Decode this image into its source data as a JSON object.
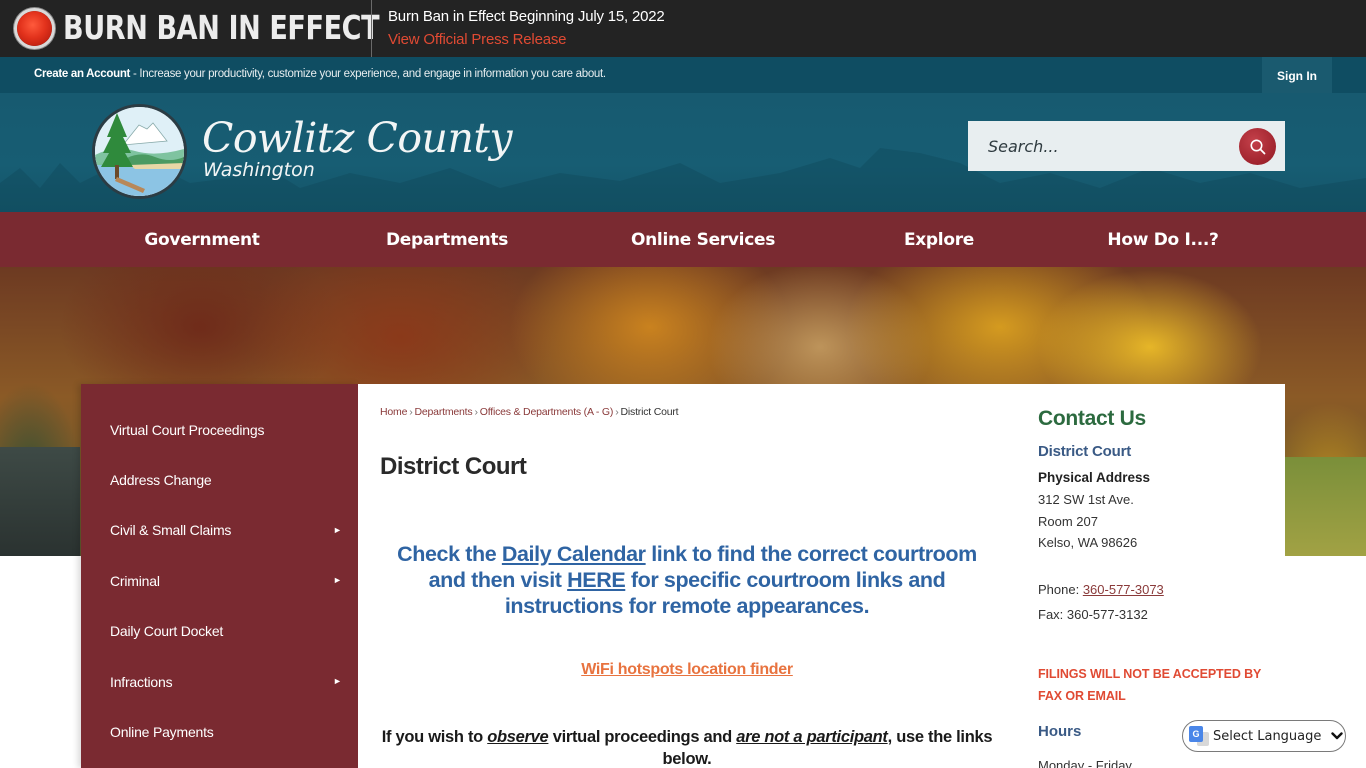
{
  "alert": {
    "title": "BURN BAN IN EFFECT",
    "headline": "Burn Ban in Effect Beginning July 15, 2022",
    "link_label": "View Official Press Release",
    "accent_color": "#e04a33"
  },
  "account": {
    "create_label": "Create an Account",
    "description": " - Increase your productivity, customize your experience, and engage in information you care about.",
    "sign_in_label": "Sign In"
  },
  "header": {
    "logo_title": "Cowlitz County",
    "logo_subtitle": "Washington",
    "search_placeholder": "Search...",
    "search_icon": "search-icon"
  },
  "nav": {
    "items": [
      {
        "label": "Government"
      },
      {
        "label": "Departments"
      },
      {
        "label": "Online Services"
      },
      {
        "label": "Explore"
      },
      {
        "label": "How Do I...?"
      }
    ]
  },
  "sidebar": {
    "items": [
      {
        "label": "Virtual Court Proceedings",
        "has_submenu": false
      },
      {
        "label": "Address Change",
        "has_submenu": false
      },
      {
        "label": "Civil & Small Claims",
        "has_submenu": true
      },
      {
        "label": "Criminal",
        "has_submenu": true
      },
      {
        "label": "Daily Court Docket",
        "has_submenu": false
      },
      {
        "label": "Infractions",
        "has_submenu": true
      },
      {
        "label": "Online Payments",
        "has_submenu": false
      }
    ],
    "arrow_glyph": "►"
  },
  "breadcrumb": {
    "items": [
      "Home",
      "Departments",
      "Offices & Departments (A - G)"
    ],
    "current": "District Court",
    "separator": "›"
  },
  "page": {
    "title": "District Court",
    "notice": {
      "part1": "Check the ",
      "link1": "Daily Calendar",
      "part2": " link to find the correct courtroom and then visit ",
      "link2": "HERE",
      "part3": " for specific courtroom links and instructions for remote appearances."
    },
    "wifi_link": "WiFi hotspots location finder",
    "observe": {
      "part1": "If you wish to ",
      "em1": "observe",
      "part2": " virtual proceedings and ",
      "em2": "are not a participant",
      "part3": ", use the links below."
    }
  },
  "contact": {
    "title": "Contact Us",
    "department": "District Court",
    "address_label": "Physical Address",
    "address_lines": [
      "312 SW 1st Ave.",
      "Room 207",
      "Kelso, WA 98626"
    ],
    "phone_label": "Phone: ",
    "phone": "360-577-3073",
    "fax": "Fax: 360-577-3132",
    "warning": "FILINGS WILL NOT BE ACCEPTED BY FAX OR EMAIL",
    "hours_title": "Hours",
    "hours_line": "Monday - Friday"
  },
  "translate": {
    "label": "Select Language"
  },
  "colors": {
    "brand_maroon": "#7a2a31",
    "header_teal": "#175a70",
    "link_blue": "#2f64a3",
    "wifi_orange": "#e8733f",
    "contact_green": "#2c6a3f"
  }
}
